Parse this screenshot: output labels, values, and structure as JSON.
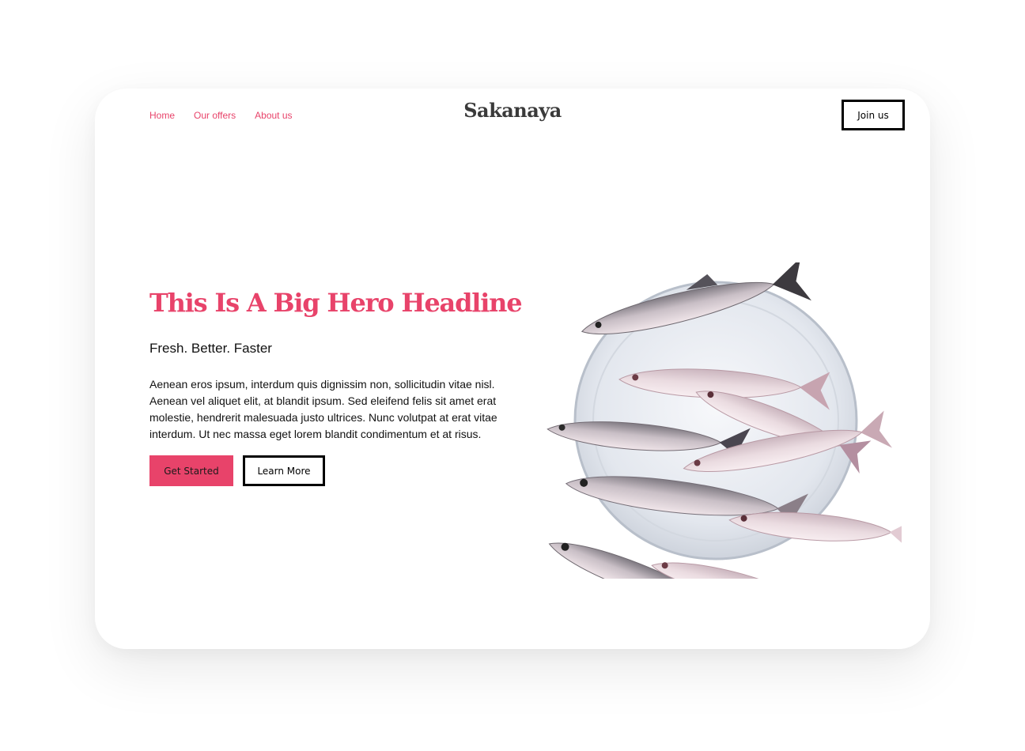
{
  "nav": {
    "items": [
      {
        "label": "Home"
      },
      {
        "label": "Our offers"
      },
      {
        "label": "About us"
      }
    ]
  },
  "brand": {
    "logo": "Sakanaya"
  },
  "header": {
    "join_label": "Join us"
  },
  "hero": {
    "headline": "This Is A Big Hero Headline",
    "subheadline": "Fresh. Better. Faster",
    "body": "Aenean eros ipsum, interdum quis dignissim non, sollicitudin vitae nisl. Aenean vel aliquet elit, at blandit ipsum. Sed eleifend felis sit amet erat molestie, hendrerit malesuada justo ultrices. Nunc volutpat at erat vitae interdum. Ut nec massa eget lorem blandit condimentum et at risus.",
    "primary_cta": "Get Started",
    "secondary_cta": "Learn More",
    "image": "plate-of-fish-image"
  },
  "colors": {
    "accent": "#e8436a",
    "text": "#111111",
    "logo": "#3a3a3a"
  }
}
